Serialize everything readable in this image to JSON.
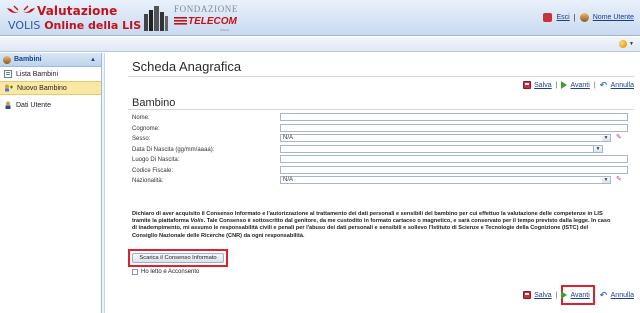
{
  "header": {
    "logo_line1": "Valutazione",
    "logo_line2_prefix": "VOLIS",
    "logo_line2": " Online della LIS",
    "fondazione": "FONDAZIONE",
    "telecom": "TELECOM",
    "telecom_sub": "ITALIA",
    "links": {
      "exit": "Esci",
      "separator": "|",
      "user": "Nome Utente"
    }
  },
  "sidebar": {
    "header": "Bambini",
    "items": [
      {
        "label": "Lista Bambini",
        "icon": "list-icon",
        "selected": false
      },
      {
        "label": "Nuovo Bambino",
        "icon": "add-child-icon",
        "selected": true
      },
      {
        "label": "Dati Utente",
        "icon": "user-icon",
        "selected": false
      }
    ]
  },
  "main": {
    "title": "Scheda Anagrafica",
    "actions": {
      "save": "Salva",
      "next": "Avanti",
      "cancel": "Annulla",
      "separator": "|"
    },
    "section": "Bambino",
    "fields": {
      "nome": {
        "label": "Nome:",
        "value": ""
      },
      "cognome": {
        "label": "Cognome:",
        "value": ""
      },
      "sesso": {
        "label": "Sesso:",
        "value": "N/A"
      },
      "data_nascita": {
        "label": "Data Di Nascita (gg/mm/aaaa):",
        "value": ""
      },
      "luogo_nascita": {
        "label": "Luogo Di Nascita:",
        "value": ""
      },
      "codice_fiscale": {
        "label": "Codice Fiscale:",
        "value": ""
      },
      "nazionalita": {
        "label": "Nazionalità:",
        "value": "N/A"
      }
    },
    "consent": {
      "p1": "Dichiaro di aver acquisito il Consenso Informato e l'autorizzazione al trattamento dei dati personali e sensibili del bambino per cui effettuo la valutazione delle competenze in LIS tramite la piattaforma ",
      "volis": "Volis",
      "p2": ". Tale Consenso è sottoscritto dal genitore, da me custodito in formato cartaceo o magnetico, e sarà conservato per il tempo previsto dalla legge. In caso di inadempimento, mi assumo le responsabilità civili e penali per l'abuso dei dati personali e sensibili e sollevo l'Istituto di Scienze e Tecnologie della Cognizione (ISTC) del Consiglio Nazionale delle Ricerche (CNR) da ogni responsabilità.",
      "download_button": "Scarica il Consenso Informato",
      "checkbox_label": "Ho letto e Acconsento",
      "checked": false
    }
  },
  "colors": {
    "accent": "#15428b",
    "brand_red": "#c4121a",
    "highlight": "#e0202a",
    "selected_bg": "#fbe7a4"
  }
}
